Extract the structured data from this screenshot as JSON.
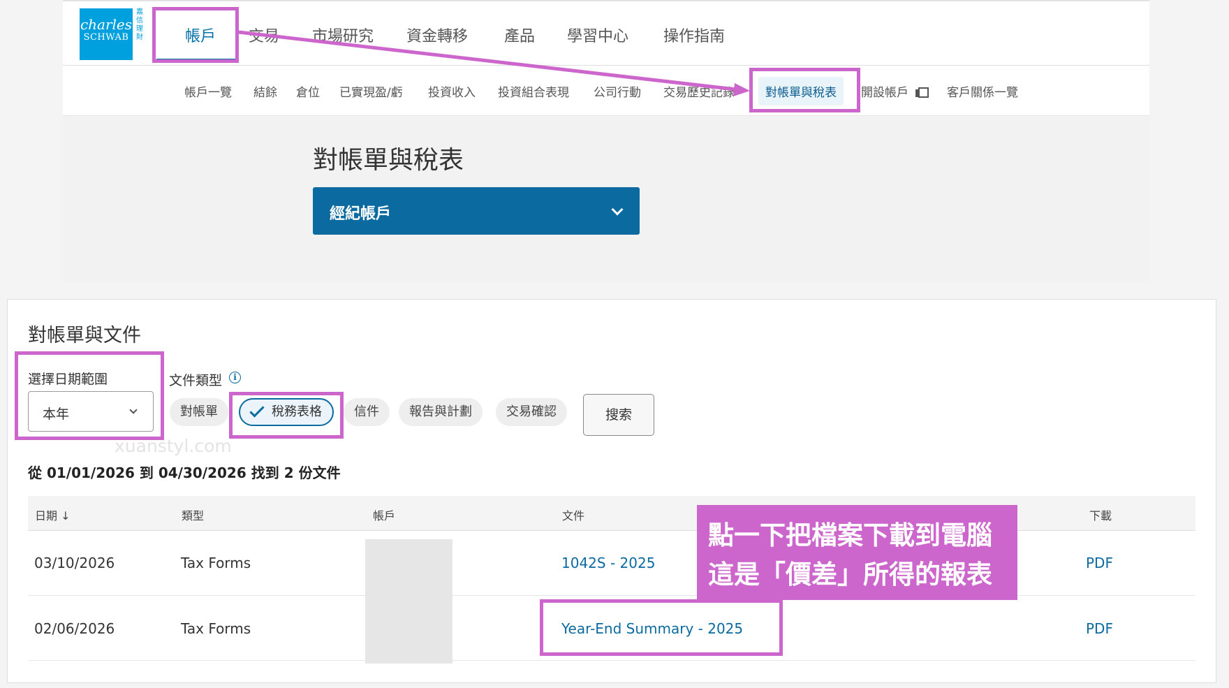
{
  "logo": {
    "line1": "charles",
    "line2": "SCHWAB",
    "side_text": "嘉信理財"
  },
  "main_nav": [
    {
      "label": "帳戶",
      "active": true
    },
    {
      "label": "交易"
    },
    {
      "label": "市場研究"
    },
    {
      "label": "資金轉移"
    },
    {
      "label": "產品"
    },
    {
      "label": "學習中心"
    },
    {
      "label": "操作指南"
    }
  ],
  "sub_nav": [
    {
      "label": "帳戶一覽"
    },
    {
      "label": "結餘"
    },
    {
      "label": "倉位"
    },
    {
      "label": "已實現盈/虧"
    },
    {
      "label": "投資收入"
    },
    {
      "label": "投資組合表現"
    },
    {
      "label": "公司行動"
    },
    {
      "label": "交易歷史記錄"
    },
    {
      "label": "對帳單與稅表",
      "active": true
    },
    {
      "label": "開設帳戶",
      "icon": "external-window-icon"
    },
    {
      "label": "客戶關係一覽"
    }
  ],
  "page": {
    "title": "對帳單與稅表",
    "account_select": "經紀帳戶"
  },
  "documents": {
    "title": "對帳單與文件",
    "date_range_label": "選擇日期範圍",
    "date_range_value": "本年",
    "doc_type_label": "文件類型",
    "info_icon": "i",
    "chips": [
      {
        "label": "對帳單"
      },
      {
        "label": "稅務表格",
        "selected": true
      },
      {
        "label": "信件"
      },
      {
        "label": "報告與計劃"
      },
      {
        "label": "交易確認"
      }
    ],
    "search_button": "搜索",
    "summary": "從 01/01/2026 到 04/30/2026 找到 2 份文件",
    "columns": [
      "日期 ↓",
      "類型",
      "帳戶",
      "文件",
      "下載"
    ],
    "rows": [
      {
        "date": "03/10/2026",
        "type": "Tax Forms",
        "account": "",
        "document": "1042S - 2025",
        "download": "PDF"
      },
      {
        "date": "02/06/2026",
        "type": "Tax Forms",
        "account": "",
        "document": "Year-End Summary - 2025",
        "download": "PDF"
      }
    ]
  },
  "annotation": {
    "line1": "點一下把檔案下載到電腦",
    "line2": "這是「價差」所得的報表",
    "color": "#cc66cc"
  },
  "watermark": "xuanstyl.com",
  "colors": {
    "brand": "#00a0df",
    "primary": "#0b6aa0",
    "highlight": "#cc66cc"
  }
}
